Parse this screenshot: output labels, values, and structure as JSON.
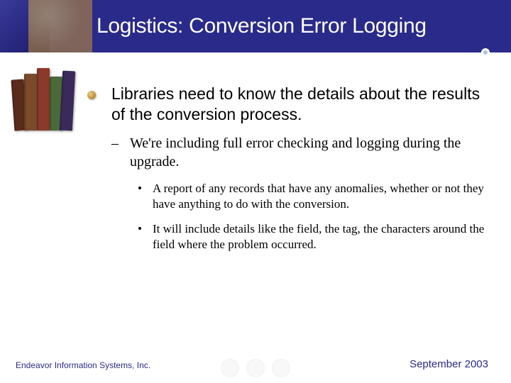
{
  "title": "Logistics: Conversion Error Logging",
  "main_point": "Libraries need to know the details about the results of the conversion process.",
  "sub1": "We're including full error checking and logging during the upgrade.",
  "sub2a": "A report of any records that have any anomalies, whether or not they have anything to do with the conversion.",
  "sub2b": "It will include details like the field, the tag, the characters around the field where the problem occurred.",
  "footer_left": "Endeavor Information Systems, Inc.",
  "footer_right": "September 2003"
}
